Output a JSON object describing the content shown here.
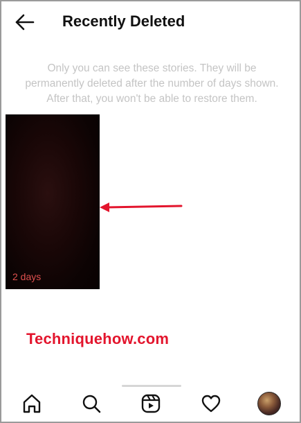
{
  "header": {
    "title": "Recently Deleted",
    "back_icon": "arrow-left-icon"
  },
  "info_text": "Only you can see these stories. They will be permanently deleted after the number of days shown. After that, you won't be able to restore them.",
  "stories": [
    {
      "days_label": "2 days"
    }
  ],
  "annotation": {
    "arrow_color": "#e3152d"
  },
  "watermark": "Techniquehow.com",
  "bottom_nav": {
    "items": [
      {
        "icon": "home-icon"
      },
      {
        "icon": "search-icon"
      },
      {
        "icon": "reels-icon"
      },
      {
        "icon": "heart-icon"
      },
      {
        "icon": "profile-avatar"
      }
    ]
  },
  "colors": {
    "info_text": "#c4c4c4",
    "days_label": "#e0504e",
    "watermark": "#e3152d"
  }
}
